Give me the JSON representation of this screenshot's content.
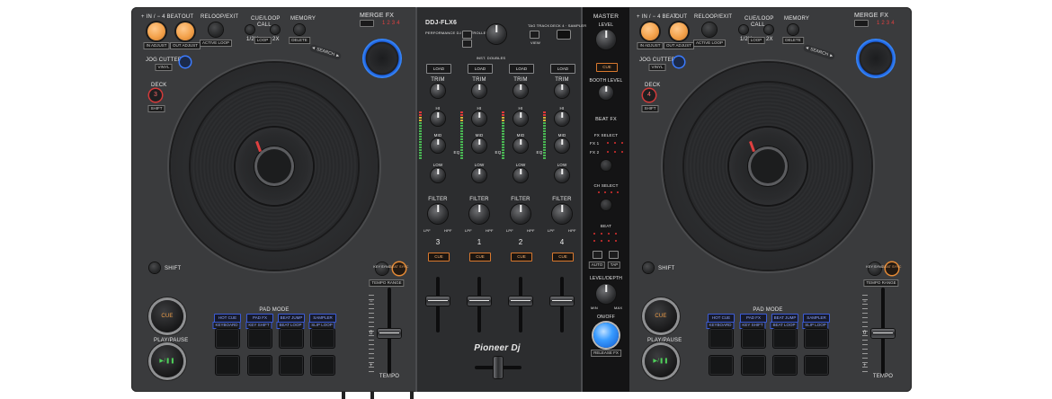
{
  "device": {
    "brand": "Pioneer DJ",
    "model": "DDJ-FLX6",
    "subtitle": "PERFORMANCE DJ CONTROLLER",
    "colors": {
      "body": "#3a3b3d",
      "accent_orange": "#f3a14a",
      "accent_blue": "#3a8cff",
      "led_red": "#e03030"
    }
  },
  "deck_left": {
    "beat_label": "+ IN / − 4 BEAT",
    "out_label": "OUT",
    "reloop_label": "RELOOP/EXIT",
    "in_adjust": "IN ADJUST",
    "out_adjust": "OUT ADJUST",
    "active_loop": "ACTIVE LOOP",
    "cue_loop_label": "CUE/LOOP",
    "call_label": "CALL",
    "loop_half": "1/2X",
    "loop_tag": "LOOP",
    "loop_double": "2X",
    "memory_label": "MEMORY",
    "delete_label": "DELETE",
    "merge_fx_label": "MERGE FX",
    "merge_numbers": "1 2 3 4",
    "jog_cutter_label": "JOG CUTTER",
    "vinyl_label": "VINYL",
    "deck_label": "DECK",
    "deck_number": "3",
    "shift_label": "SHIFT",
    "search_label": "◄ SEARCH ►",
    "key_sync": "KEY SYNC",
    "beat_sync": "BEAT SYNC",
    "tempo_range": "TEMPO RANGE",
    "pad_mode_label": "PAD MODE",
    "pad_modes": [
      "HOT CUE",
      "PAD FX",
      "BEAT JUMP",
      "SAMPLER"
    ],
    "pad_modes_shift": [
      "KEYBOARD",
      "KEY SHIFT",
      "BEAT LOOP",
      "SLIP LOOP"
    ],
    "cue_label": "CUE",
    "play_label": "PLAY/PAUSE",
    "play_icon": "▶/❚❚",
    "tempo_label": "TEMPO",
    "tempo_marks": [
      "−",
      "0",
      "+"
    ]
  },
  "deck_right": {
    "beat_label": "+ IN / − 4 BEAT",
    "out_label": "OUT",
    "reloop_label": "RELOOP/EXIT",
    "in_adjust": "IN ADJUST",
    "out_adjust": "OUT ADJUST",
    "active_loop": "ACTIVE LOOP",
    "cue_loop_label": "CUE/LOOP",
    "call_label": "CALL",
    "loop_half": "1/2X",
    "loop_tag": "LOOP",
    "loop_double": "2X",
    "memory_label": "MEMORY",
    "delete_label": "DELETE",
    "merge_fx_label": "MERGE FX",
    "merge_numbers": "1 2 3 4",
    "jog_cutter_label": "JOG CUTTER",
    "vinyl_label": "VINYL",
    "deck_label": "DECK",
    "deck_number": "4",
    "shift_label": "SHIFT",
    "search_label": "◄ SEARCH ►",
    "key_sync": "KEY SYNC",
    "beat_sync": "BEAT SYNC",
    "tempo_range": "TEMPO RANGE",
    "pad_mode_label": "PAD MODE",
    "pad_modes": [
      "HOT CUE",
      "PAD FX",
      "BEAT JUMP",
      "SAMPLER"
    ],
    "pad_modes_shift": [
      "KEYBOARD",
      "KEY SHIFT",
      "BEAT LOOP",
      "SLIP LOOP"
    ],
    "cue_label": "CUE",
    "play_label": "PLAY/PAUSE",
    "play_icon": "▶/❚❚",
    "tempo_label": "TEMPO",
    "tempo_marks": [
      "−",
      "0",
      "+"
    ]
  },
  "mixer": {
    "model": "DDJ-FLX6",
    "subtitle": "PERFORMANCE DJ CONTROLLER",
    "tag_track": "TAG TRACK",
    "view_label": "VIEW",
    "deck_sampler": "DECK 4 · SAMPLER",
    "inst_doubles": "INST. DOUBLES",
    "load_label": "LOAD",
    "trim_label": "TRIM",
    "hi_label": "HI",
    "mid_label": "MID",
    "low_label": "LOW",
    "eq_label": "EQ",
    "filter_label": "FILTER",
    "lpf": "LPF",
    "hpf": "HPF",
    "cue_label": "CUE",
    "channels": [
      "3",
      "1",
      "2",
      "4"
    ],
    "brand_logo": "Pioneer Dj"
  },
  "master": {
    "master_label": "MASTER",
    "level_label": "LEVEL",
    "cue_label": "CUE",
    "booth_label": "BOOTH LEVEL",
    "beat_fx_label": "BEAT FX",
    "fx_select_label": "FX SELECT",
    "fx1": "FX 1",
    "fx2": "FX 2",
    "ch_select_label": "CH SELECT",
    "beat_label": "BEAT",
    "auto_label": "AUTO",
    "tap_label": "TAP",
    "level_depth_label": "LEVEL/DEPTH",
    "min_label": "MIN",
    "max_label": "MAX",
    "onoff_label": "ON/OFF",
    "release_fx": "RELEASE FX"
  }
}
